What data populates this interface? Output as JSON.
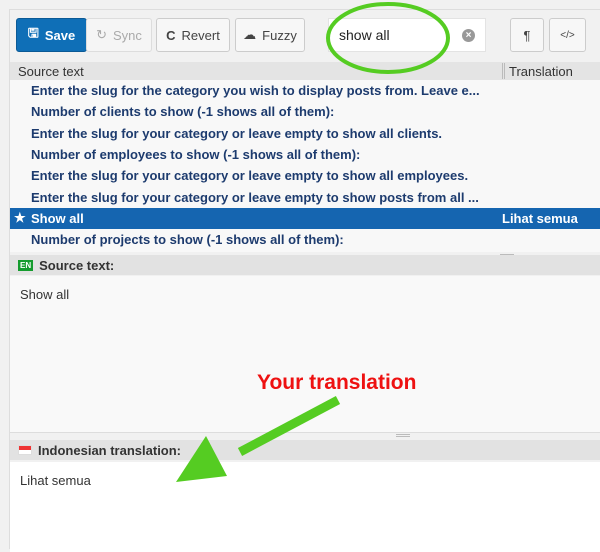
{
  "toolbar": {
    "save": "Save",
    "sync": "Sync",
    "revert": "Revert",
    "fuzzy": "Fuzzy",
    "search_value": "show all",
    "pilcrow": "¶",
    "code": "</>"
  },
  "table": {
    "col_source": "Source text",
    "col_translation": "Translation",
    "rows": [
      {
        "source": "Enter the slug for the category you wish to display posts from. Leave e...",
        "translation": ""
      },
      {
        "source": "Number of clients to show (-1 shows all of them):",
        "translation": ""
      },
      {
        "source": "Enter the slug for your category or leave empty to show all clients.",
        "translation": ""
      },
      {
        "source": "Number of employees to show (-1 shows all of them):",
        "translation": ""
      },
      {
        "source": "Enter the slug for your category or leave empty to show all employees.",
        "translation": ""
      },
      {
        "source": "Enter the slug for your category or leave empty to show posts from all ...",
        "translation": ""
      },
      {
        "source": "Show all",
        "translation": "Lihat semua",
        "selected": true
      },
      {
        "source": "Number of projects to show (-1 shows all of them):",
        "translation": ""
      }
    ]
  },
  "source_panel": {
    "lang_badge": "EN",
    "label": "Source text:",
    "text": "Show all"
  },
  "translation_panel": {
    "label": "Indonesian translation:",
    "text": "Lihat semua"
  },
  "annotation": {
    "text": "Your translation",
    "text_color": "#ee1111",
    "arrow_color": "#55cc22"
  },
  "colors": {
    "primary": "#0f6fb7",
    "selected_row": "#1565b0"
  }
}
